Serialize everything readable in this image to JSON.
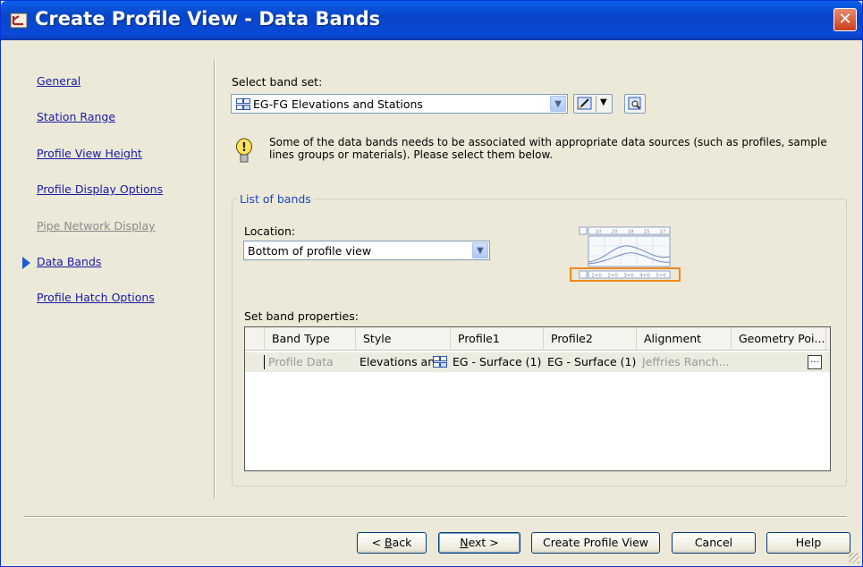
{
  "window": {
    "title": "Create Profile View - Data Bands",
    "close_glyph": "✕"
  },
  "nav": {
    "items": [
      {
        "label": "General",
        "disabled": false
      },
      {
        "label": "Station Range",
        "disabled": false
      },
      {
        "label": "Profile View Height",
        "disabled": false
      },
      {
        "label": "Profile Display Options",
        "disabled": false
      },
      {
        "label": "Pipe Network Display",
        "disabled": true
      },
      {
        "label": "Data Bands",
        "disabled": false,
        "current": true
      },
      {
        "label": "Profile Hatch Options",
        "disabled": false
      }
    ]
  },
  "band_set": {
    "label": "Select band set:",
    "value": "EG-FG Elevations and Stations"
  },
  "info": {
    "text": "Some of the data bands needs to be associated with appropriate data sources (such as profiles, sample lines groups or materials). Please select them below."
  },
  "list_of_bands": {
    "title": "List of bands",
    "location_label": "Location:",
    "location_value": "Bottom of profile view",
    "preview_top_labels": [
      "10",
      "20",
      "18",
      "15",
      "17"
    ],
    "preview_bottom_labels": [
      "1+0",
      "2+0",
      "3+0",
      "4+0",
      "5+0"
    ],
    "set_band_properties_label": "Set band properties:"
  },
  "grid": {
    "columns": [
      "Band Type",
      "Style",
      "Profile1",
      "Profile2",
      "Alignment",
      "Geometry Poi..."
    ],
    "rows": [
      {
        "band_type": "Profile Data",
        "style": "Elevations and",
        "profile1": "EG - Surface (1)",
        "profile2": "EG - Surface (1)",
        "alignment": "Jeffries Ranch...",
        "geometry_button": "..."
      }
    ]
  },
  "buttons": {
    "back": {
      "mnemonic": "B",
      "rest": "ack",
      "prefix": "< "
    },
    "next": {
      "mnemonic": "N",
      "rest": "ext >"
    },
    "create": "Create Profile View",
    "cancel": "Cancel",
    "help": "Help"
  },
  "colors": {
    "accent": "#1e5ad0",
    "link": "#1a1aa8",
    "preview_highlight": "#f0881e"
  }
}
